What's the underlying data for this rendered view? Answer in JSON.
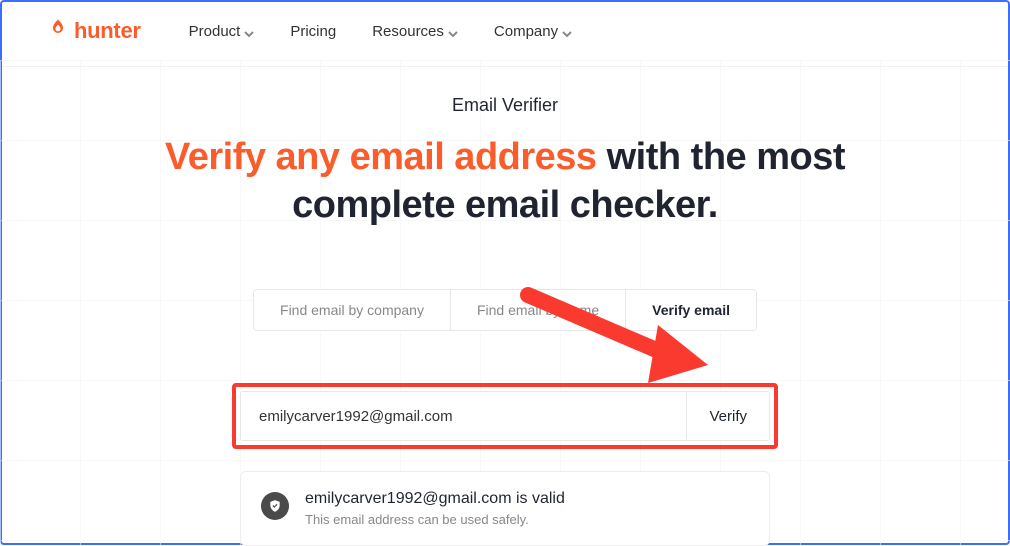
{
  "brand": {
    "name": "hunter"
  },
  "nav": {
    "items": [
      {
        "label": "Product",
        "has_dropdown": true
      },
      {
        "label": "Pricing",
        "has_dropdown": false
      },
      {
        "label": "Resources",
        "has_dropdown": true
      },
      {
        "label": "Company",
        "has_dropdown": true
      }
    ]
  },
  "hero": {
    "eyebrow": "Email Verifier",
    "headline_accent": "Verify any email address",
    "headline_rest": " with the most complete email checker."
  },
  "tabs": {
    "items": [
      {
        "label": "Find email by company",
        "active": false
      },
      {
        "label": "Find email by name",
        "active": false
      },
      {
        "label": "Verify email",
        "active": true
      }
    ]
  },
  "form": {
    "email_value": "emilycarver1992@gmail.com",
    "verify_label": "Verify"
  },
  "result": {
    "title": "emilycarver1992@gmail.com is valid",
    "subtitle": "This email address can be used safely."
  },
  "colors": {
    "brand": "#fa5c2b",
    "annotation": "#fa3a2f",
    "frame": "#3b6dff"
  }
}
